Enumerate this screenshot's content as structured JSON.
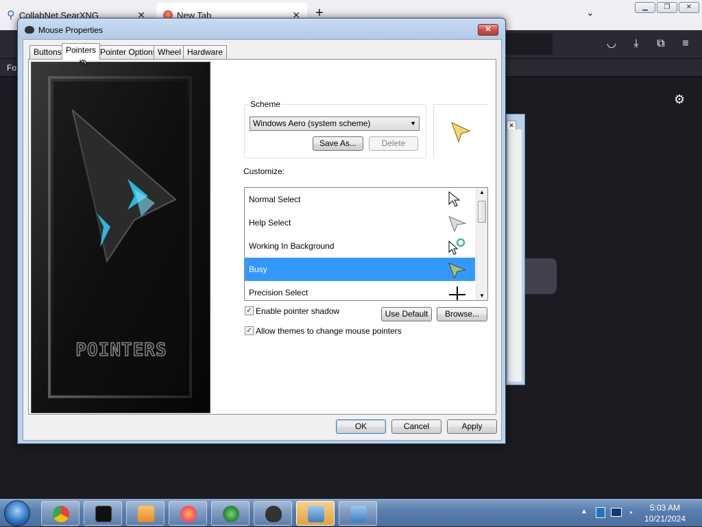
{
  "browser": {
    "tabs": [
      {
        "label": "CollabNet SearXNG"
      },
      {
        "label": "New Tab"
      }
    ],
    "new_tab_label": "+",
    "bookmark_text": "Fo"
  },
  "dialog": {
    "title": "Mouse Properties",
    "close_label": "✕",
    "tabs": [
      {
        "label": "Buttons"
      },
      {
        "label": "Pointers"
      },
      {
        "label": "Pointer Options"
      },
      {
        "label": "Wheel"
      },
      {
        "label": "Hardware"
      }
    ],
    "preview_text": "POINTERS",
    "scheme": {
      "label": "Scheme",
      "value": "Windows Aero (system scheme)",
      "save_as": "Save As...",
      "delete": "Delete"
    },
    "customize_label": "Customize:",
    "cursor_list": [
      {
        "label": "Normal Select",
        "icon": "arrow-cursor-icon",
        "selected": false
      },
      {
        "label": "Help Select",
        "icon": "help-cursor-icon",
        "selected": false
      },
      {
        "label": "Working In Background",
        "icon": "working-cursor-icon",
        "selected": false
      },
      {
        "label": "Busy",
        "icon": "busy-cursor-icon",
        "selected": true
      },
      {
        "label": "Precision Select",
        "icon": "crosshair-cursor-icon",
        "selected": false
      }
    ],
    "enable_shadow": {
      "label": "Enable pointer shadow",
      "checked": true
    },
    "allow_themes": {
      "label": "Allow themes to change mouse pointers",
      "checked": true
    },
    "use_default": "Use Default",
    "browse": "Browse...",
    "ok": "OK",
    "cancel": "Cancel",
    "apply": "Apply"
  },
  "taskbar": {
    "time": "5:03 AM",
    "date": "10/21/2024"
  },
  "colors": {
    "selection": "#3399ff",
    "taskbar": "#5a7fae",
    "browser_dark": "#2b2a33"
  }
}
